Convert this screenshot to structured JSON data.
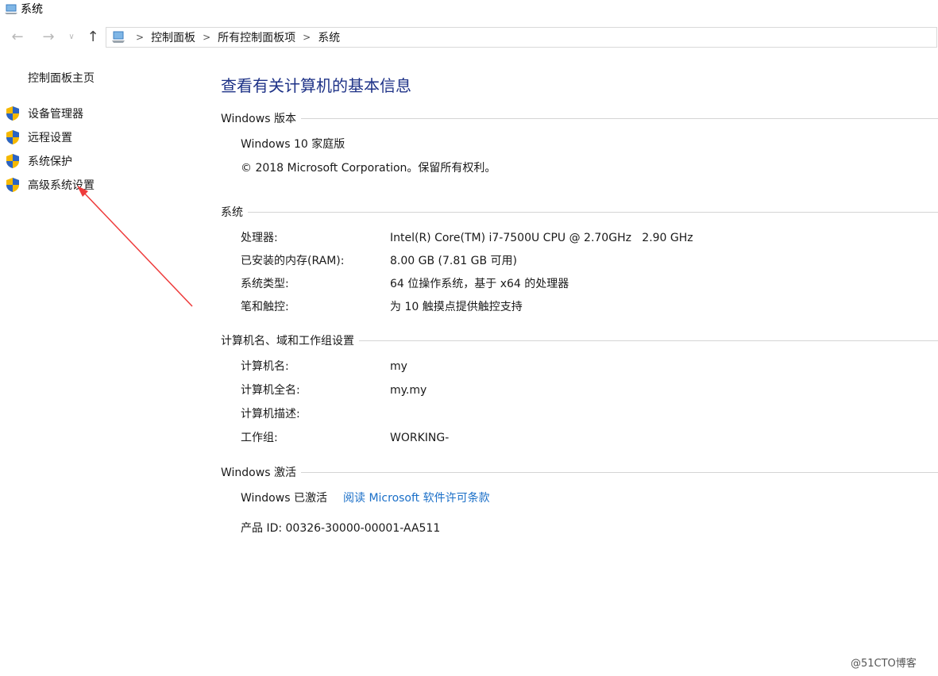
{
  "window": {
    "title": "系统"
  },
  "breadcrumb": [
    "控制面板",
    "所有控制面板项",
    "系统"
  ],
  "sidebar": {
    "home": "控制面板主页",
    "items": [
      {
        "label": "设备管理器",
        "icon": "uac-shield-icon"
      },
      {
        "label": "远程设置",
        "icon": "uac-shield-icon"
      },
      {
        "label": "系统保护",
        "icon": "uac-shield-icon"
      },
      {
        "label": "高级系统设置",
        "icon": "uac-shield-icon"
      }
    ]
  },
  "main": {
    "title": "查看有关计算机的基本信息",
    "edition": {
      "heading": "Windows 版本",
      "name": "Windows 10 家庭版",
      "copyright": "© 2018 Microsoft Corporation。保留所有权利。"
    },
    "system": {
      "heading": "系统",
      "rows": [
        {
          "key": "处理器:",
          "value": "Intel(R) Core(TM) i7-7500U CPU @ 2.70GHz   2.90 GHz"
        },
        {
          "key": "已安装的内存(RAM):",
          "value": "8.00 GB (7.81 GB 可用)"
        },
        {
          "key": "系统类型:",
          "value": "64 位操作系统，基于 x64 的处理器"
        },
        {
          "key": "笔和触控:",
          "value": "为 10 触摸点提供触控支持"
        }
      ]
    },
    "computer": {
      "heading": "计算机名、域和工作组设置",
      "rows": [
        {
          "key": "计算机名:",
          "value": "my"
        },
        {
          "key": "计算机全名:",
          "value": "my.my"
        },
        {
          "key": "计算机描述:",
          "value": ""
        },
        {
          "key": "工作组:",
          "value": "WORKING-"
        }
      ]
    },
    "activation": {
      "heading": "Windows 激活",
      "status": "Windows 已激活",
      "license_link": "阅读 Microsoft 软件许可条款",
      "product_id": "产品 ID: 00326-30000-00001-AA511"
    }
  },
  "watermark": "@51CTO博客",
  "colors": {
    "title": "#1e3287",
    "link": "#1a6fc8",
    "annotation_arrow": "#ee3b3b"
  }
}
